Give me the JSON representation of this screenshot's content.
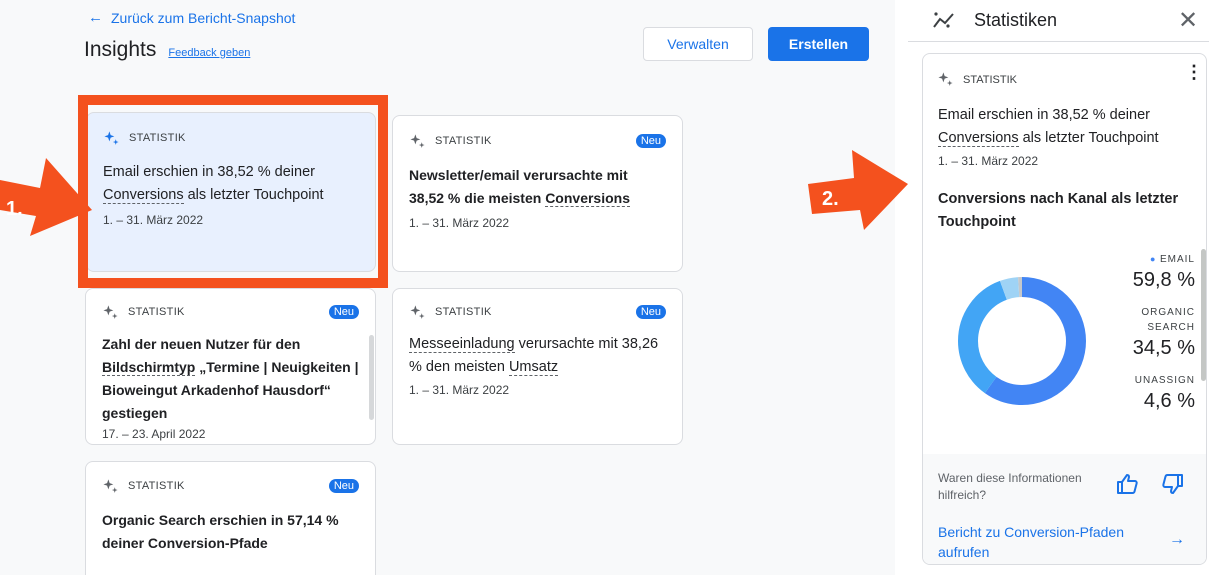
{
  "header": {
    "back_label": "Zurück zum Bericht-Snapshot",
    "title": "Insights",
    "feedback": "Feedback geben",
    "manage": "Verwalten",
    "create": "Erstellen"
  },
  "cards": [
    {
      "label": "STATISTIK",
      "text_parts": [
        "Email erschien in 38,52 % deiner ",
        "Conversions",
        " als letzter Touchpoint"
      ],
      "date": "1. – 31. März 2022",
      "badge": ""
    },
    {
      "label": "STATISTIK",
      "text_parts": [
        "Newsletter/email verursachte mit 38,52 % die meisten ",
        "Conversions",
        ""
      ],
      "date": "1. – 31. März 2022",
      "badge": "Neu"
    },
    {
      "label": "STATISTIK",
      "text_parts": [
        "Zahl der neuen Nutzer für den ",
        "Bildschirmtyp",
        " „Termine | Neuigkeiten | Bioweingut Arkadenhof Hausdorf“ gestiegen"
      ],
      "date": "17. – 23. April 2022",
      "badge": "Neu"
    },
    {
      "label": "STATISTIK",
      "text_parts": [
        "",
        "Messeeinladung",
        " verursachte mit 38,26 % den meisten ",
        "Umsatz"
      ],
      "date": "1. – 31. März 2022",
      "badge": "Neu"
    },
    {
      "label": "STATISTIK",
      "text_parts": [
        "Organic Search erschien in 57,14 % deiner Conversion-Pfade",
        "",
        ""
      ],
      "date": "",
      "badge": "Neu"
    }
  ],
  "annotations": {
    "one": "1.",
    "two": "2.",
    "color": "#f4511e"
  },
  "panel": {
    "title": "Statistiken",
    "label": "STATISTIK",
    "text_parts": [
      "Email erschien in 38,52 % deiner ",
      "Conversions",
      " als letzter Touchpoint"
    ],
    "date": "1. – 31. März 2022",
    "subtitle": "Conversions nach Kanal als letzter Touchpoint",
    "helpful": "Waren diese Informationen hilfreich?",
    "report_link": "Bericht zu Conversion-Pfaden aufrufen"
  },
  "chart_data": {
    "type": "pie",
    "categories": [
      "EMAIL",
      "ORGANIC SEARCH",
      "UNASSIGN"
    ],
    "values": [
      59.8,
      34.5,
      4.6
    ],
    "value_labels": [
      "59,8 %",
      "34,5 %",
      "4,6 %"
    ],
    "colors": [
      "#4285f4",
      "#42a5f5",
      "#9fd3f5"
    ],
    "remainder_color": "#c5c8cb"
  }
}
